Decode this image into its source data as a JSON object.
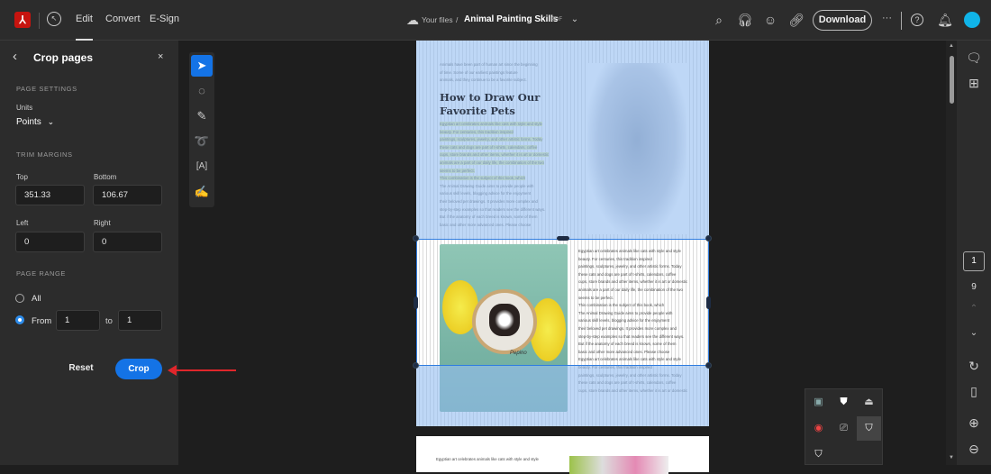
{
  "topbar": {
    "nav": [
      "Edit",
      "Convert",
      "E-Sign"
    ],
    "breadcrumb_root": "Your files",
    "separator": "/",
    "doc_title": "Animal Painting Skills",
    "doc_type": "PDF",
    "download_label": "Download",
    "more": "···"
  },
  "panel": {
    "title": "Crop pages",
    "page_settings": "PAGE SETTINGS",
    "units_label": "Units",
    "units_value": "Points",
    "trim_margins": "TRIM MARGINS",
    "top_label": "Top",
    "top_value": "351.33",
    "bottom_label": "Bottom",
    "bottom_value": "106.67",
    "left_label": "Left",
    "left_value": "0",
    "right_label": "Right",
    "right_value": "0",
    "page_range": "PAGE RANGE",
    "all_label": "All",
    "from_label": "From",
    "from_value": "1",
    "to_label": "to",
    "to_value": "1",
    "reset_label": "Reset",
    "crop_label": "Crop"
  },
  "page": {
    "intro": [
      "Animals have been part of human art since the beginning",
      "of time. Some of our earliest paintings feature",
      "animals, and they continue to be a favorite subject."
    ],
    "heading": "How to Draw Our Favorite Pets",
    "highlighted": [
      "Egyptian art celebrates animals like cats with style and style",
      "beauty. For centuries, this tradition inspired",
      "paintings, sculptures, jewelry, and other artistic forms. Today",
      "these cats and dogs are part of t-shirts, calendars, coffee",
      "cups, store brands and other items, whether it is art or domestic",
      "animals are a part of our daily life, the combination of the two",
      "seems to be perfect.",
      "This combination is the subject of this book, which"
    ],
    "body": [
      "The Animal Drawing Guide aims to provide people with",
      "various skill levels, blogging advice for the enjoyment",
      "their beloved pet drawings. It provides more complex and",
      "step-by-step examples so that readers see the different ways.",
      "But if the anatomy of each breed is known, some of them",
      "basic and other more advanced ones. Please choose"
    ],
    "right_col": [
      "Egyptian art celebrates animals like cats with style and style",
      "beauty. For centuries, this tradition inspired",
      "paintings, sculptures, jewelry, and other artistic forms. Today",
      "these cats and dogs are part of t-shirts, calendars, coffee",
      "cups, store brands and other items, whether it is art or domestic",
      "animals are a part of our daily life, the combination of the two",
      "seems to be perfect.",
      "This combination is the subject of this book, which",
      "The Animal Drawing Guide aims to provide people with",
      "various skill levels, blogging advice for the enjoyment",
      "their beloved pet drawings. It provides more complex and",
      "step-by-step examples so that readers see the different ways.",
      "But if the anatomy of each breed is known, some of them",
      "basic and other more advanced ones. Please choose"
    ],
    "page2_line": "Egyptian art celebrates animals like cats with style and style",
    "pet_name": "Pepino"
  },
  "rail": {
    "current_page": "1",
    "total_pages": "9"
  },
  "colors": {
    "accent": "#1473e6",
    "crop_overlay": "#96bef0",
    "adobe_red": "#c7140f"
  }
}
